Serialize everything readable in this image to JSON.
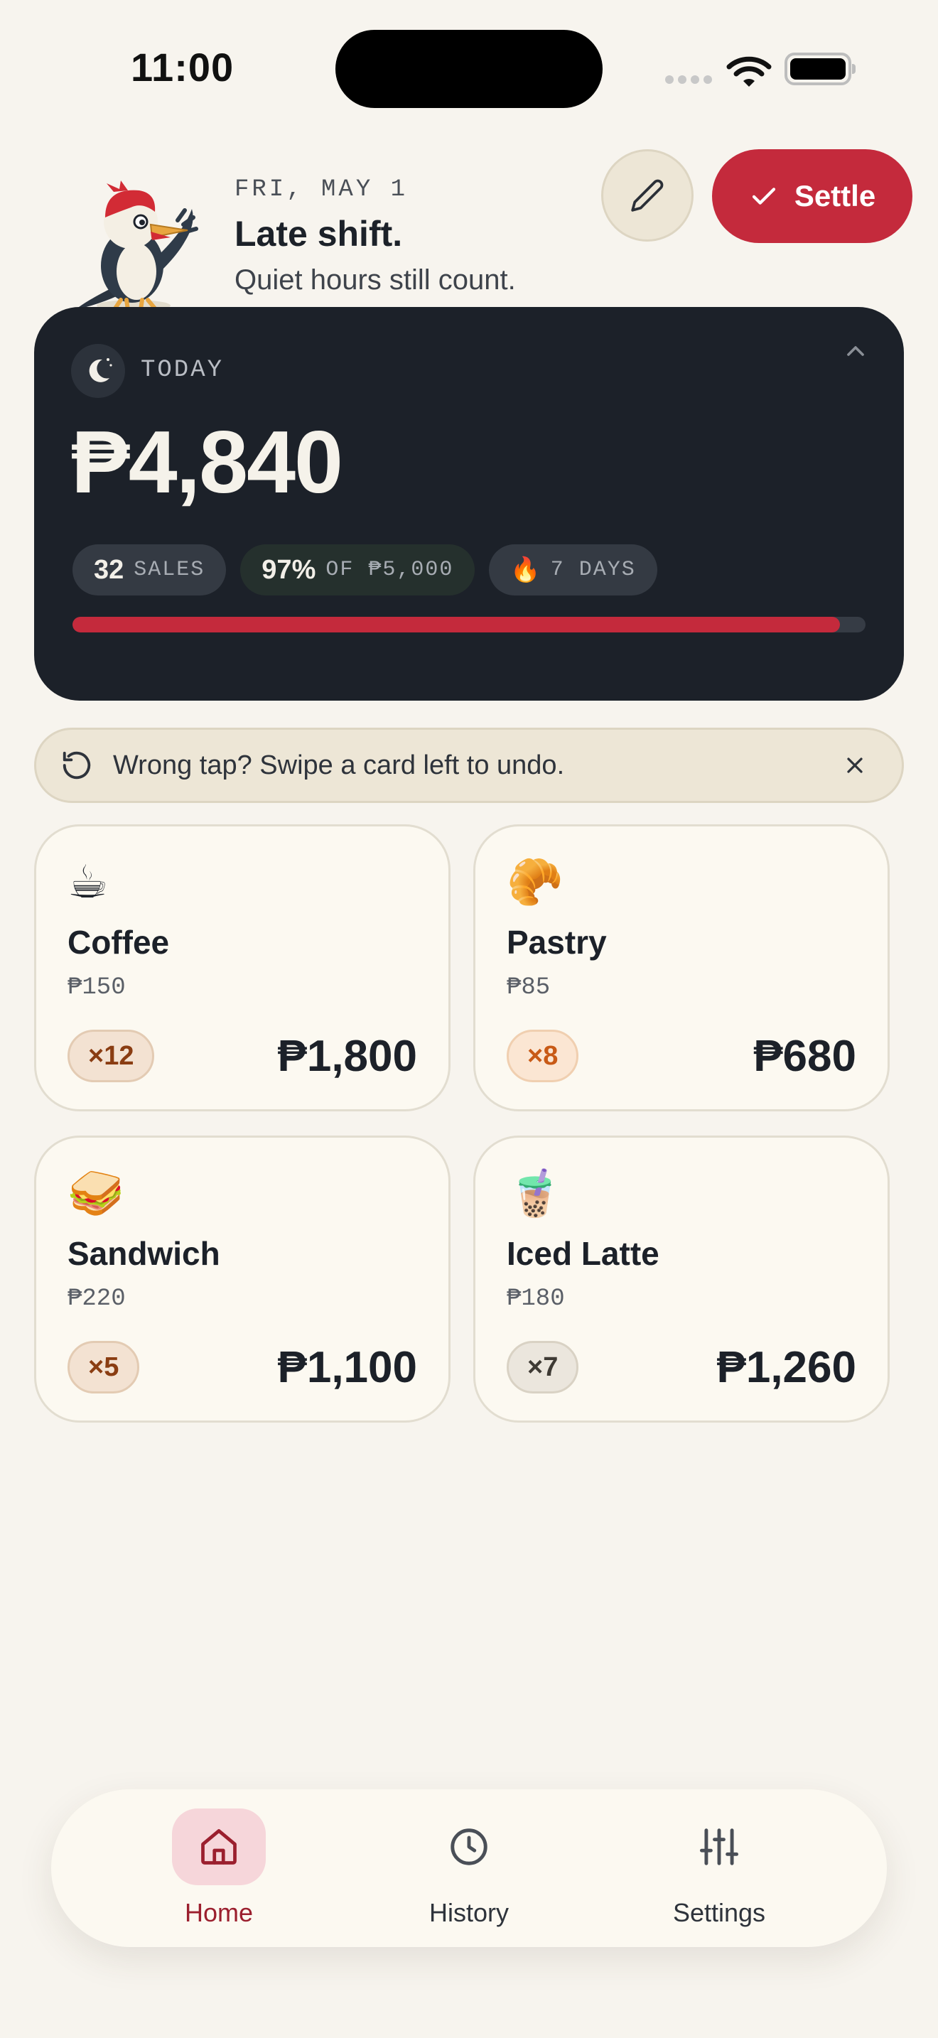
{
  "status_bar": {
    "time": "11:00"
  },
  "header": {
    "date": "FRI, MAY 1",
    "headline": "Late shift.",
    "subline": "Quiet hours still count.",
    "settle_label": "Settle"
  },
  "today": {
    "label": "TODAY",
    "total": "₱4,840",
    "sales_count": "32",
    "sales_label": "SALES",
    "goal_percent": "97%",
    "goal_label": "OF ₱5,000",
    "streak_emoji": "🔥",
    "streak_label": "7 DAYS",
    "progress_fraction": 0.968
  },
  "undo_banner": {
    "text": "Wrong tap? Swipe a card left to undo."
  },
  "products": [
    {
      "emoji": "☕",
      "name": "Coffee",
      "price": "₱150",
      "qty": "×12",
      "subtotal": "₱1,800"
    },
    {
      "emoji": "🥐",
      "name": "Pastry",
      "price": "₱85",
      "qty": "×8",
      "subtotal": "₱680"
    },
    {
      "emoji": "🥪",
      "name": "Sandwich",
      "price": "₱220",
      "qty": "×5",
      "subtotal": "₱1,100"
    },
    {
      "emoji": "🧋",
      "name": "Iced Latte",
      "price": "₱180",
      "qty": "×7",
      "subtotal": "₱1,260"
    }
  ],
  "nav": {
    "home": "Home",
    "history": "History",
    "settings": "Settings"
  },
  "colors": {
    "accent": "#c42a3c",
    "dark_card": "#1c2129",
    "background": "#f7f4ee",
    "qty_coffee": "#f3e2d2",
    "qty_pastry": "#fbe6d3",
    "qty_sandwich": "#f3e2d2",
    "qty_latte": "#ebe6dd"
  },
  "icons": {
    "edit": "pencil-icon",
    "settle": "check-icon",
    "today": "moon-icon",
    "undo": "undo-icon",
    "dismiss": "close-icon",
    "home": "home-icon",
    "history": "clock-icon",
    "settings": "sliders-icon"
  }
}
